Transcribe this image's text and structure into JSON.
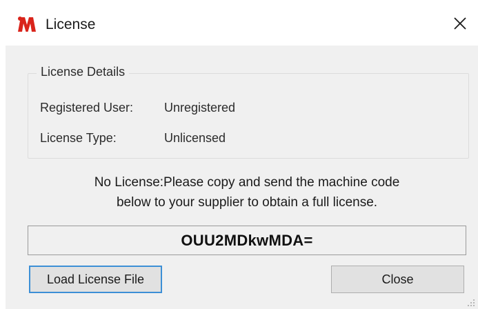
{
  "window": {
    "title": "License",
    "icon": "m-logo-icon",
    "close_glyph": "✕"
  },
  "group": {
    "legend": "License Details",
    "registered_user_label": "Registered User:",
    "registered_user_value": "Unregistered",
    "license_type_label": "License Type:",
    "license_type_value": "Unlicensed"
  },
  "message": {
    "line1": "No License:Please copy and send the machine code",
    "line2": "below to your supplier to obtain a full license."
  },
  "machine_code": "OUU2MDkwMDA=",
  "buttons": {
    "load_label": "Load License File",
    "close_label": "Close"
  },
  "colors": {
    "client_bg": "#f0f0f0",
    "focus_border": "#3c8fd6",
    "logo_red": "#d9241b"
  }
}
